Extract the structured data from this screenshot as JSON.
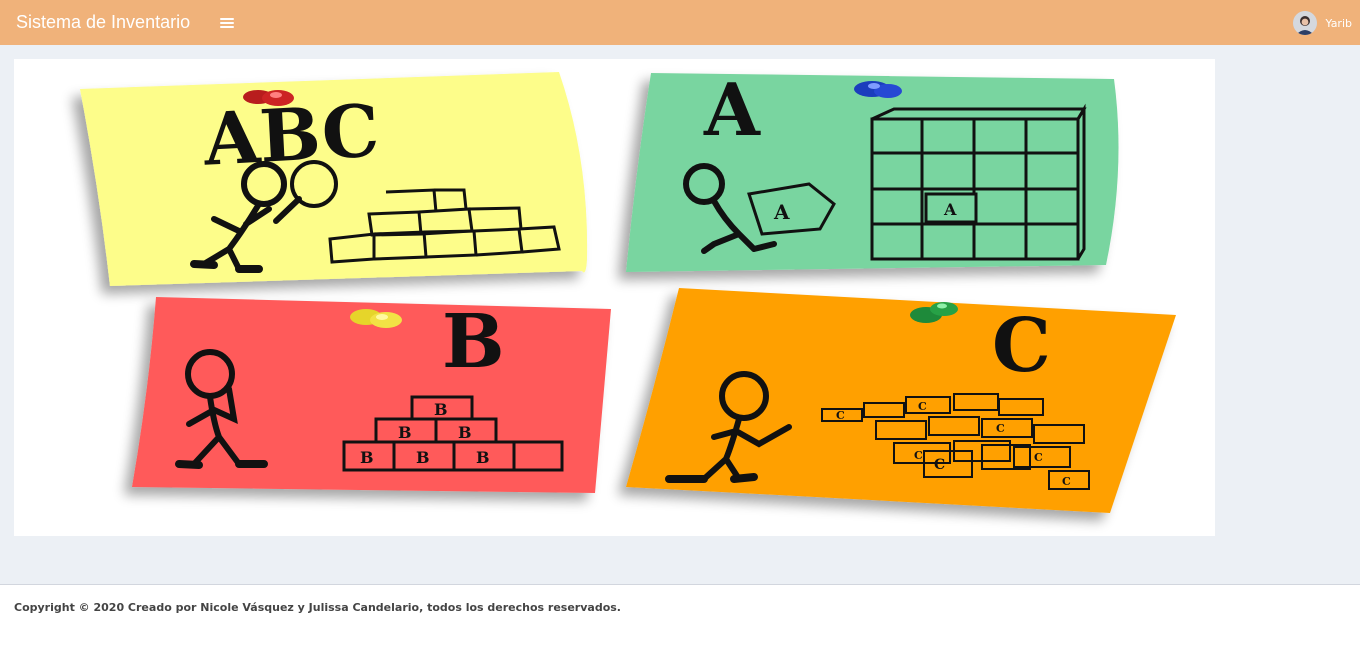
{
  "header": {
    "brand": "Sistema de Inventario",
    "menu_icon": "bars-icon",
    "user_name": "Yarib",
    "background_color": "#f0b27a"
  },
  "main": {
    "illustration": {
      "icon": "abc-inventory-classification-illustration",
      "notes": [
        {
          "letter": "ABC",
          "color": "#fdfd8a"
        },
        {
          "letter": "A",
          "color": "#79d5a0"
        },
        {
          "letter": "B",
          "color": "#ff5a5a"
        },
        {
          "letter": "C",
          "color": "#ffa000"
        }
      ],
      "box_labels": {
        "a": "A",
        "b": "B",
        "c": "C"
      }
    }
  },
  "footer": {
    "copyright": "Copyright © 2020 Creado por Nicole Vásquez y Julissa Candelario, todos los derechos reservados."
  }
}
